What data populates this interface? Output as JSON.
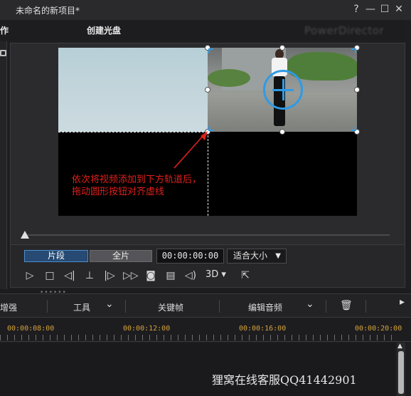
{
  "window": {
    "title": "未命名的新项目*",
    "help": "?",
    "minimize": "—",
    "maximize": "☐",
    "close": "✕"
  },
  "tabs": {
    "left_partial": "作",
    "create_disc": "创建光盘",
    "brand": "PowerDirector"
  },
  "preview": {
    "annotation_line1": "依次将视频添加到下方轨道后，",
    "annotation_line2": "拖动圆形按钮对齐虚线"
  },
  "playback": {
    "mode_clip": "片段",
    "mode_full": "全片",
    "timecode": "00:00:00:00",
    "fit_label": "适合大小",
    "fit_caret": "▼",
    "threed_label": "3D ▾"
  },
  "controls": {
    "play": "▷",
    "stop": "□",
    "prev_frame": "◁|",
    "mark": "⊥",
    "next_frame": "|▷",
    "fast_forward": "▷▷",
    "snapshot": "◙",
    "subtitles": "▤",
    "volume": "◁)",
    "undock": "⇱"
  },
  "timeline_toolbar": {
    "enhance": "增强",
    "tools": "工具",
    "tools_caret": "⌄",
    "keyframe": "关键帧",
    "edit_audio": "编辑音频",
    "edit_audio_caret": "⌄",
    "delete": "🗑",
    "more": "▸"
  },
  "ruler": {
    "labels": [
      "00:00:08:00",
      "00:00:12:00",
      "00:00:16:00",
      "00:00:20:00"
    ]
  },
  "watermark": "狸窝在线客服QQ41442901",
  "colors": {
    "accent_blue": "#2e9be6",
    "annotation_red": "#e0201c",
    "ruler_orange": "#d6a23a"
  }
}
